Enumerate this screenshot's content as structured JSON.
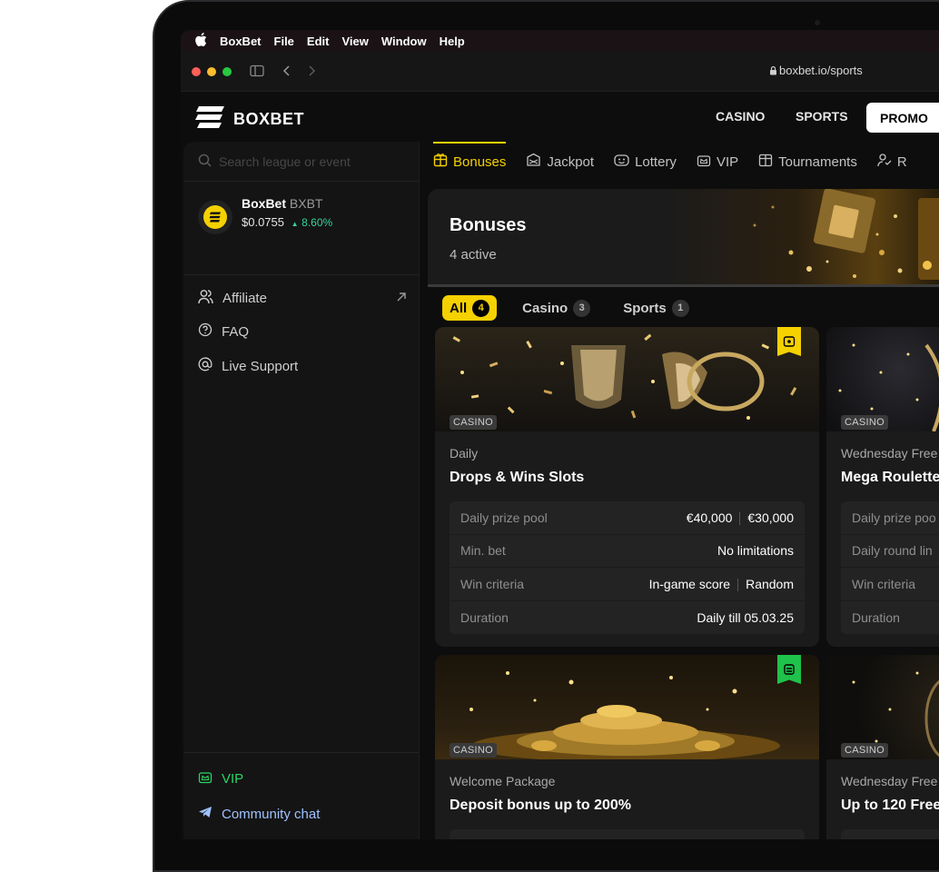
{
  "menubar": {
    "app": "BoxBet",
    "items": [
      "File",
      "Edit",
      "View",
      "Window",
      "Help"
    ]
  },
  "browser": {
    "url": "boxbet.io/sports"
  },
  "header": {
    "logo": "BOXBET",
    "nav": [
      "CASINO",
      "SPORTS"
    ],
    "promo": "PROMO"
  },
  "sidebar": {
    "search_placeholder": "Search league or event",
    "token": {
      "name": "BoxBet",
      "symbol": "BXBT",
      "price": "$0.0755",
      "change": "8.60%"
    },
    "links": [
      {
        "label": "Affiliate"
      },
      {
        "label": "FAQ"
      },
      {
        "label": "Live Support"
      }
    ],
    "bottom": {
      "vip": "VIP",
      "community": "Community chat"
    }
  },
  "tabs": [
    {
      "label": "Bonuses",
      "icon": "gift-icon"
    },
    {
      "label": "Jackpot",
      "icon": "jackpot-icon"
    },
    {
      "label": "Lottery",
      "icon": "ticket-icon"
    },
    {
      "label": "VIP",
      "icon": "crown-icon"
    },
    {
      "label": "Tournaments",
      "icon": "calendar-icon"
    },
    {
      "label": "R",
      "icon": "referral-icon"
    }
  ],
  "hero": {
    "title": "Bonuses",
    "subtitle": "4 active"
  },
  "filters": [
    {
      "label": "All",
      "count": "4"
    },
    {
      "label": "Casino",
      "count": "3"
    },
    {
      "label": "Sports",
      "count": "1"
    }
  ],
  "cards": [
    {
      "badge": "CASINO",
      "category": "Daily",
      "title": "Drops & Wins Slots",
      "rows": [
        {
          "key": "Daily prize pool",
          "values": [
            "€40,000",
            "€30,000"
          ]
        },
        {
          "key": "Min. bet",
          "values": [
            "No limitations"
          ]
        },
        {
          "key": "Win criteria",
          "values": [
            "In-game score",
            "Random"
          ]
        },
        {
          "key": "Duration",
          "values": [
            "Daily till 05.03.25"
          ]
        }
      ]
    },
    {
      "badge": "CASINO",
      "category": "Wednesday Free",
      "title": "Mega Roulette",
      "rows": [
        {
          "key": "Daily prize poo",
          "values": []
        },
        {
          "key": "Daily round lin",
          "values": []
        },
        {
          "key": "Win criteria",
          "values": []
        },
        {
          "key": "Duration",
          "values": []
        }
      ]
    },
    {
      "badge": "CASINO",
      "category": "Welcome Package",
      "title": "Deposit bonus up to 200%"
    },
    {
      "badge": "CASINO",
      "category": "Wednesday Free",
      "title": "Up to 120 Free"
    }
  ],
  "colors": {
    "accent": "#f5d100",
    "vip_green": "#2bd464",
    "flag_green": "#1fc24a",
    "up": "#36d399"
  }
}
